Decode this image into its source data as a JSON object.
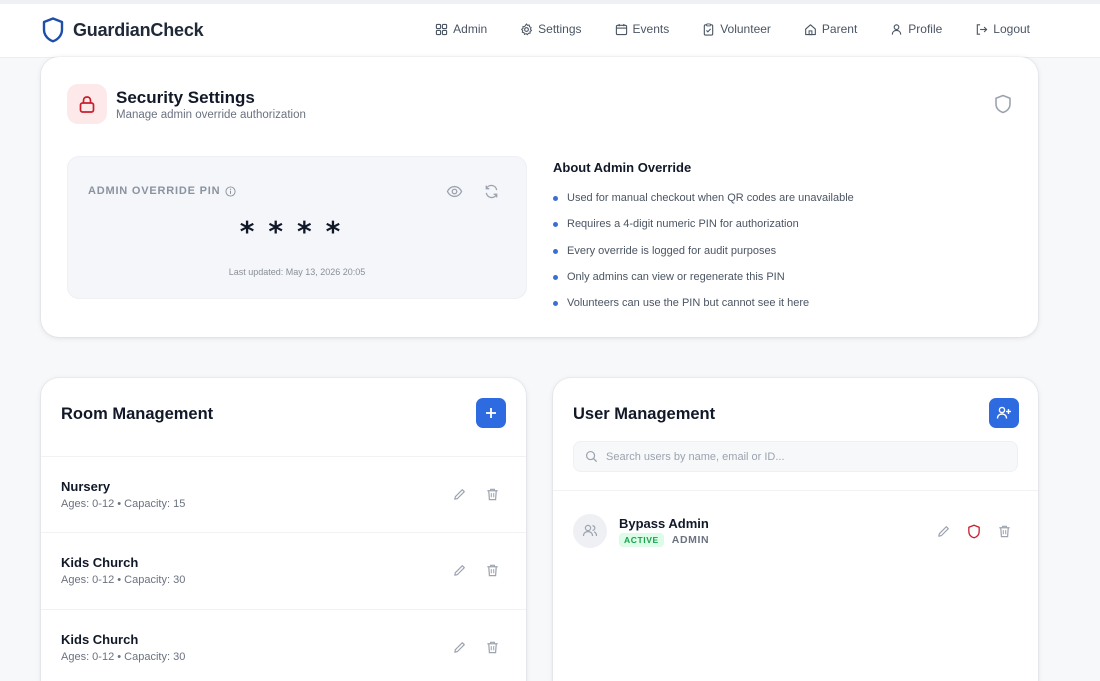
{
  "nav": {
    "brand": "GuardianCheck",
    "links": [
      {
        "label": "Admin",
        "icon": "grid-icon"
      },
      {
        "label": "Settings",
        "icon": "gear-icon"
      },
      {
        "label": "Events",
        "icon": "calendar-icon"
      },
      {
        "label": "Volunteer",
        "icon": "clipboard-check-icon"
      },
      {
        "label": "Parent",
        "icon": "home-icon"
      },
      {
        "label": "Profile",
        "icon": "user-icon"
      },
      {
        "label": "Logout",
        "icon": "logout-icon"
      }
    ]
  },
  "security": {
    "title": "Security Settings",
    "subtitle": "Manage admin override authorization",
    "pin_label": "ADMIN OVERRIDE PIN",
    "pin_masked": "****",
    "last_updated": "Last updated: May 13, 2026 20:05",
    "about_title": "About Admin Override",
    "about_items": [
      "Used for manual checkout when QR codes are unavailable",
      "Requires a 4-digit numeric PIN for authorization",
      "Every override is logged for audit purposes",
      "Only admins can view or regenerate this PIN",
      "Volunteers can use the PIN but cannot see it here"
    ]
  },
  "rooms": {
    "title": "Room Management",
    "items": [
      {
        "name": "Nursery",
        "meta": "Ages: 0-12 • Capacity: 15"
      },
      {
        "name": "Kids Church",
        "meta": "Ages: 0-12 • Capacity: 30"
      },
      {
        "name": "Kids Church",
        "meta": "Ages: 0-12 • Capacity: 30"
      }
    ]
  },
  "users": {
    "title": "User Management",
    "search_placeholder": "Search users by name, email or ID...",
    "items": [
      {
        "name": "Bypass Admin",
        "status": "ACTIVE",
        "role": "ADMIN"
      }
    ]
  },
  "colors": {
    "accent": "#2f6be0",
    "brand_shield": "#1e4fa8",
    "danger": "#c81e2c",
    "success": "#16a34a"
  }
}
